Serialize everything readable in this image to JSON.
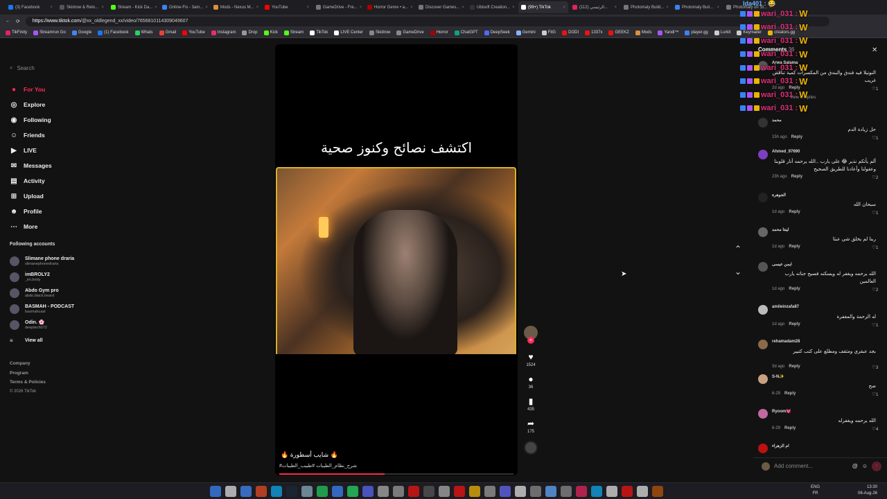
{
  "browser": {
    "tabs": [
      {
        "label": "(3) Facebook",
        "color": "#1877f2"
      },
      {
        "label": "Skidrow & Relo...",
        "color": "#555"
      },
      {
        "label": "Stream - Kick Da...",
        "color": "#53fc18"
      },
      {
        "label": "Online-Fix - 3am...",
        "color": "#3b82f6"
      },
      {
        "label": "Mods - Nexus M...",
        "color": "#d98f40"
      },
      {
        "label": "YouTube",
        "color": "#ff0000"
      },
      {
        "label": "GameDrive - Fre...",
        "color": "#777"
      },
      {
        "label": "Horror Genre • a...",
        "color": "#a00"
      },
      {
        "label": "Discover Games...",
        "color": "#777"
      },
      {
        "label": "Ubisoft Creation...",
        "color": "#333"
      },
      {
        "label": "(99+) TikTok",
        "color": "#fff",
        "active": true
      },
      {
        "label": "(112) الرئيسي...",
        "color": "#e0245e"
      },
      {
        "label": "Photomaly Build...",
        "color": "#777"
      },
      {
        "label": "Photomaly Buil...",
        "color": "#3b82f6"
      },
      {
        "label": "Photomaly on St...",
        "color": "#777"
      }
    ],
    "url_host": "https://www.tiktok.com",
    "url_path": "/@xx_oldlegend_xx/video/7656810114309049607",
    "bookmarks": [
      {
        "label": "TikFinity",
        "color": "#e0245e"
      },
      {
        "label": "Streamrun Go",
        "color": "#a855f7"
      },
      {
        "label": "Google",
        "color": "#4285f4"
      },
      {
        "label": "(1) Facebook",
        "color": "#1877f2"
      },
      {
        "label": "Whats",
        "color": "#25d366"
      },
      {
        "label": "Gmail",
        "color": "#ea4335"
      },
      {
        "label": "YouTube",
        "color": "#ff0000"
      },
      {
        "label": "Instagram",
        "color": "#e1306c"
      },
      {
        "label": "Drop",
        "color": "#999"
      },
      {
        "label": "Kick",
        "color": "#53fc18"
      },
      {
        "label": "Stream",
        "color": "#53fc18"
      },
      {
        "label": "TikTok",
        "color": "#fff"
      },
      {
        "label": "LIVE Center",
        "color": "#fff"
      },
      {
        "label": "Skidrow",
        "color": "#888"
      },
      {
        "label": "GameDrive",
        "color": "#888"
      },
      {
        "label": "Horror",
        "color": "#a00"
      },
      {
        "label": "ChatGPT",
        "color": "#10a37f"
      },
      {
        "label": "DeepSeek",
        "color": "#4d6bfe"
      },
      {
        "label": "Gemini",
        "color": "#8ab4f8"
      },
      {
        "label": "FitG",
        "color": "#ccc"
      },
      {
        "label": "DODI",
        "color": "#e11"
      },
      {
        "label": "1337x",
        "color": "#e11"
      },
      {
        "label": "GEEKZ",
        "color": "#e11"
      },
      {
        "label": "Mods",
        "color": "#d98f40"
      },
      {
        "label": "Yandi™",
        "color": "#a855f7"
      },
      {
        "label": "player.gg",
        "color": "#3b82f6"
      },
      {
        "label": "Lurkit",
        "color": "#ccc"
      },
      {
        "label": "Keymailer",
        "color": "#ccc"
      },
      {
        "label": "creators.gg",
        "color": "#eab308"
      }
    ]
  },
  "sidebar": {
    "search_placeholder": "Search",
    "nav": [
      {
        "label": "For You",
        "icon": "●",
        "active": true
      },
      {
        "label": "Explore",
        "icon": "◎"
      },
      {
        "label": "Following",
        "icon": "◉"
      },
      {
        "label": "Friends",
        "icon": "☺"
      },
      {
        "label": "LIVE",
        "icon": "▶"
      },
      {
        "label": "Messages",
        "icon": "✉"
      },
      {
        "label": "Activity",
        "icon": "▤"
      },
      {
        "label": "Upload",
        "icon": "⊞"
      },
      {
        "label": "Profile",
        "icon": "☻"
      },
      {
        "label": "More",
        "icon": "⋯"
      }
    ],
    "following_title": "Following accounts",
    "accounts": [
      {
        "name": "Slimane phone draria",
        "handle": "slimanephonedraria"
      },
      {
        "name": "imBROLY2",
        "handle": "_im.broly"
      },
      {
        "name": "Abdo Gym pro",
        "handle": "abdo.black.beard"
      },
      {
        "name": "BASMAH - PODCAST",
        "handle": "basmahcast"
      },
      {
        "name": "Odin. 🌸",
        "handle": "deeptech072"
      }
    ],
    "view_all": "View all",
    "footer": [
      "Company",
      "Program",
      "Terms & Policies"
    ],
    "copyright": "© 2026 TikTok"
  },
  "video": {
    "title": "اكتشف نصائح وكنوز صحية",
    "caption": "🔥 شايب أسطورة 🔥",
    "tags": "#شرح_نظام_الطيبات #طبيب_الطيبات",
    "progress": 0.45,
    "likes": "1524",
    "comments": "36",
    "saves": "435",
    "shares": "175"
  },
  "comments": {
    "header": "Comments",
    "count": "36",
    "items": [
      {
        "user": "Arwa Salama",
        "text": "النوتيلا فيه فندق والبندق من المكسرات كمية تناقض غريب",
        "time": "2d ago",
        "likes": "1",
        "view_replies": "View 6 replies"
      },
      {
        "user": "محمد",
        "text": "حل زيادة الدم",
        "time": "15h ago",
        "likes": "1"
      },
      {
        "user": "Ahmed_97690",
        "text": "ألم يأتكم نذير 😂 على يارب ..الله يرحمه أنار قلوبنا وعقولنا وأعادنا للطريق الصحيح",
        "time": "23h ago",
        "likes": "2"
      },
      {
        "user": "الجوهرة",
        "text": "سبحان الله",
        "time": "1d ago",
        "likes": "1"
      },
      {
        "user": "لينتا محمد",
        "text": "ربنا لم يخلق شي عبثا",
        "time": "1d ago",
        "likes": "1"
      },
      {
        "user": "ايمن عيسى",
        "text": "الله يرحمه ويغفر له ويسكنه فسيح جناته يارب العالمين",
        "time": "1d ago",
        "likes": "2"
      },
      {
        "user": "amileinzafa87",
        "text": "له الرحمة والمغفرة",
        "time": "1d ago",
        "likes": "1"
      },
      {
        "user": "rehamadam28",
        "text": "بجد عبقري ومثقف ومطلع على كتب كتيير",
        "time": "3d ago",
        "likes": "3"
      },
      {
        "user": "S-N✨",
        "text": "صح",
        "time": "6-29",
        "likes": "1"
      },
      {
        "user": "Ryoom💓",
        "text": "الله يرحمه ويغفرله",
        "time": "6-29",
        "likes": "4"
      },
      {
        "user": "ام الزهراء",
        "text": "",
        "time": "",
        "likes": ""
      }
    ],
    "reply_label": "Reply",
    "input_placeholder": "Add comment..."
  },
  "overlay": {
    "top_text": "lda401 : 😂",
    "rows": [
      "wari_031 :",
      "wari_031 :",
      "wari_031 :",
      "wari_031 :",
      "wari_031 :",
      "wari_031 :",
      "wari_031 :",
      "wari_031 :"
    ]
  },
  "taskbar": {
    "lang": "ENG",
    "region": "FR",
    "time": "13:30",
    "date": "06-Aug-26"
  }
}
